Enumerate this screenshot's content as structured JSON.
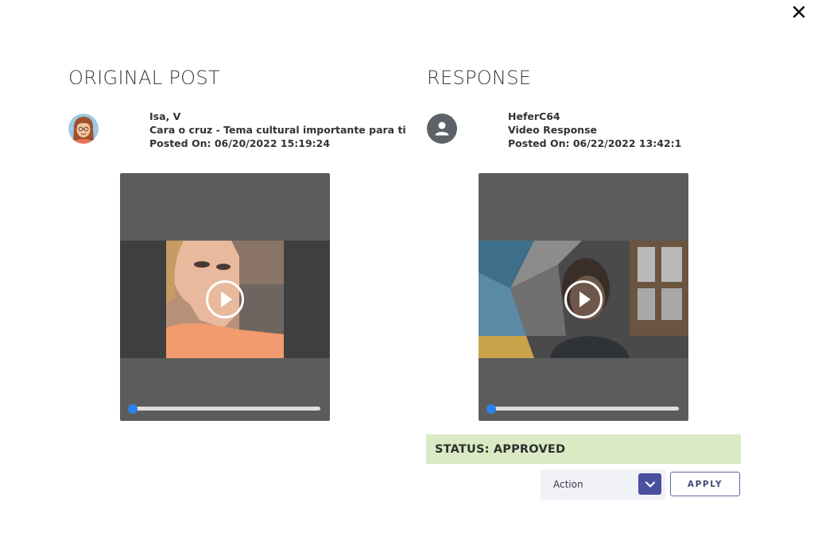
{
  "close_icon": "close-icon",
  "original": {
    "heading": "ORIGINAL POST",
    "author": "Isa, V",
    "subject": "Cara o cruz - Tema cultural importante para ti",
    "posted_on": "Posted On: 06/20/2022 15:19:24",
    "avatar_icon": "illustrated-woman-avatar",
    "video": {
      "play_icon": "play-icon",
      "progress": 0
    }
  },
  "response": {
    "heading": "RESPONSE",
    "author": "HeferC64",
    "subject": "Video Response",
    "posted_on": "Posted On: 06/22/2022 13:42:1",
    "avatar_icon": "user-icon",
    "video": {
      "play_icon": "play-icon",
      "progress": 0
    },
    "status": "STATUS: APPROVED",
    "action": {
      "selected": "Action",
      "chevron_icon": "chevron-down-icon"
    },
    "apply_label": "APPLY"
  },
  "colors": {
    "status_bg": "#d9eac4",
    "accent": "#4a4fa0",
    "seek_knob": "#2f80ed",
    "player_bg": "#5c5c5c"
  }
}
